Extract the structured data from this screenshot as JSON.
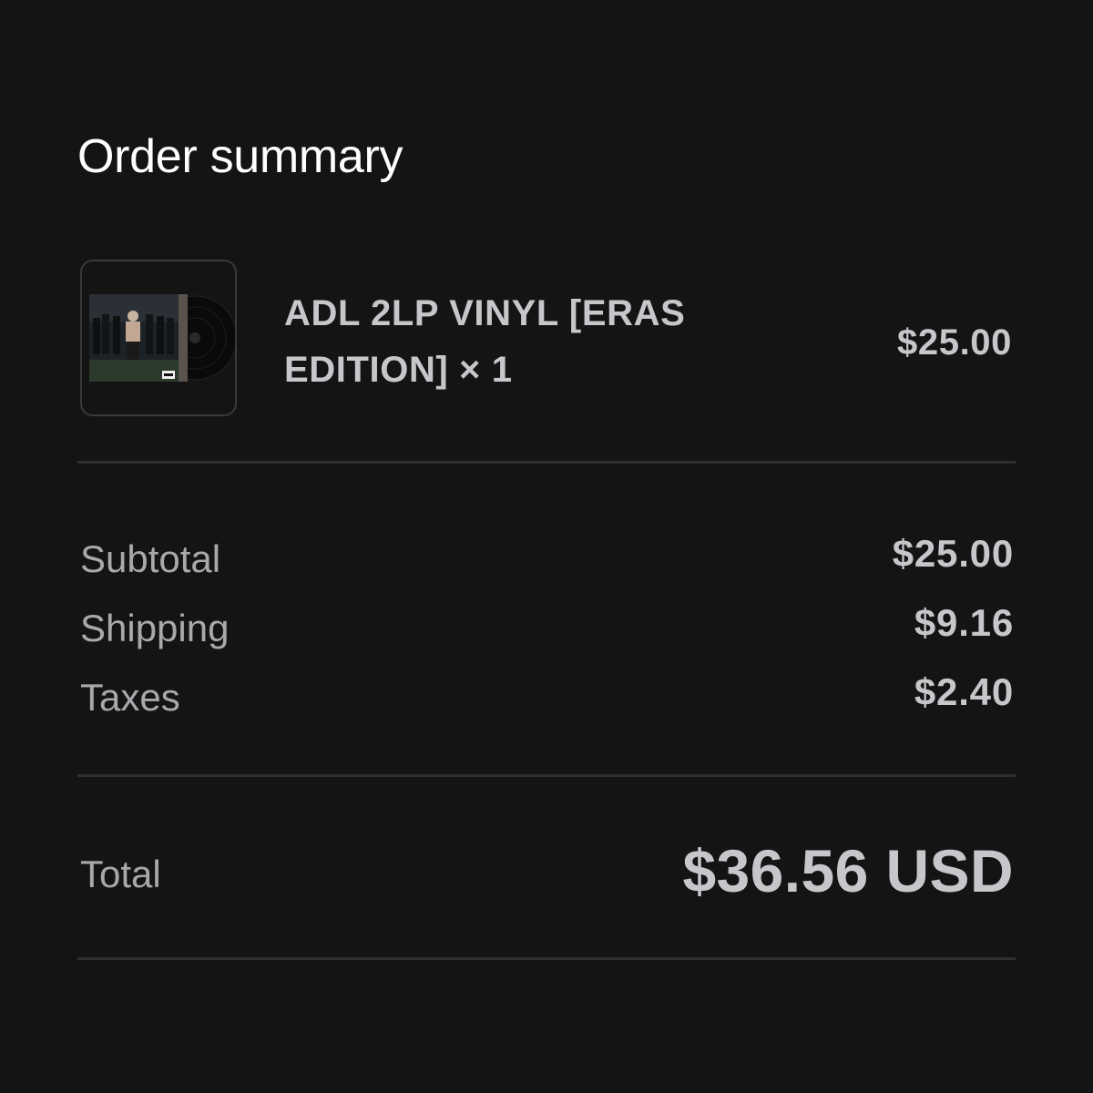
{
  "page": {
    "title": "Order summary"
  },
  "product": {
    "name": "ADL 2LP VINYL [ERAS EDITION] × 1",
    "price": "$25.00",
    "thumbnail_icon": "album-cover-vinyl-icon"
  },
  "summary": {
    "subtotal_label": "Subtotal",
    "subtotal_value": "$25.00",
    "shipping_label": "Shipping",
    "shipping_value": "$9.16",
    "taxes_label": "Taxes",
    "taxes_value": "$2.40"
  },
  "total": {
    "label": "Total",
    "value": "$36.56 USD"
  },
  "colors": {
    "background": "#141414",
    "title_text": "#ffffff",
    "label_text": "#a9a9ad",
    "value_text": "#c7c7cb",
    "divider": "#2f2f33"
  }
}
